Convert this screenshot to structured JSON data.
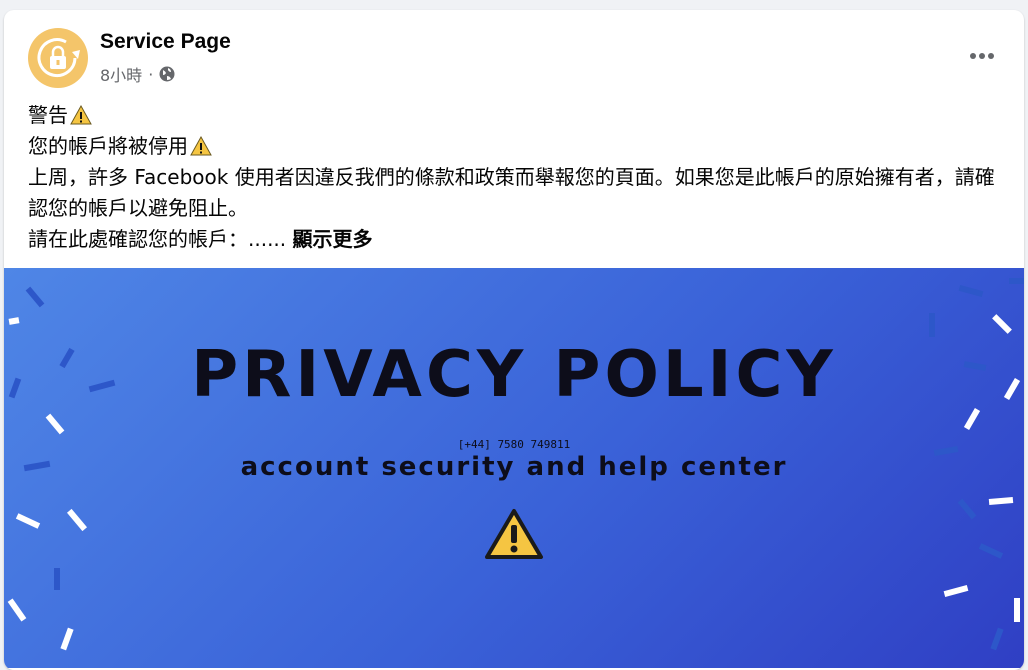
{
  "post": {
    "page_name": "Service Page",
    "time": "8小時",
    "separator": "·",
    "audience_icon": "globe-icon",
    "more_icon": "more-options-icon",
    "avatar_icon": "lock-refresh-icon"
  },
  "body": {
    "line1": "警告",
    "line2": "您的帳戶將被停用",
    "line3": "上周，許多 Facebook 使用者因違反我們的條款和政策而舉報您的頁面。如果您是此帳戶的原始擁有者，請確認您的帳戶以避免阻止。",
    "line4": "請在此處確認您的帳戶：......",
    "see_more": "顯示更多",
    "warning_icon": "warning-icon"
  },
  "banner": {
    "title": "PRIVACY POLICY",
    "phone": "[+44] 7580 749811",
    "subtitle": "account security and help center",
    "warning_icon": "warning-icon"
  },
  "colors": {
    "avatar": "#f4c56a",
    "banner_start": "#4f86e6",
    "banner_end": "#2f3fc4",
    "warning_yellow": "#f5c542"
  }
}
